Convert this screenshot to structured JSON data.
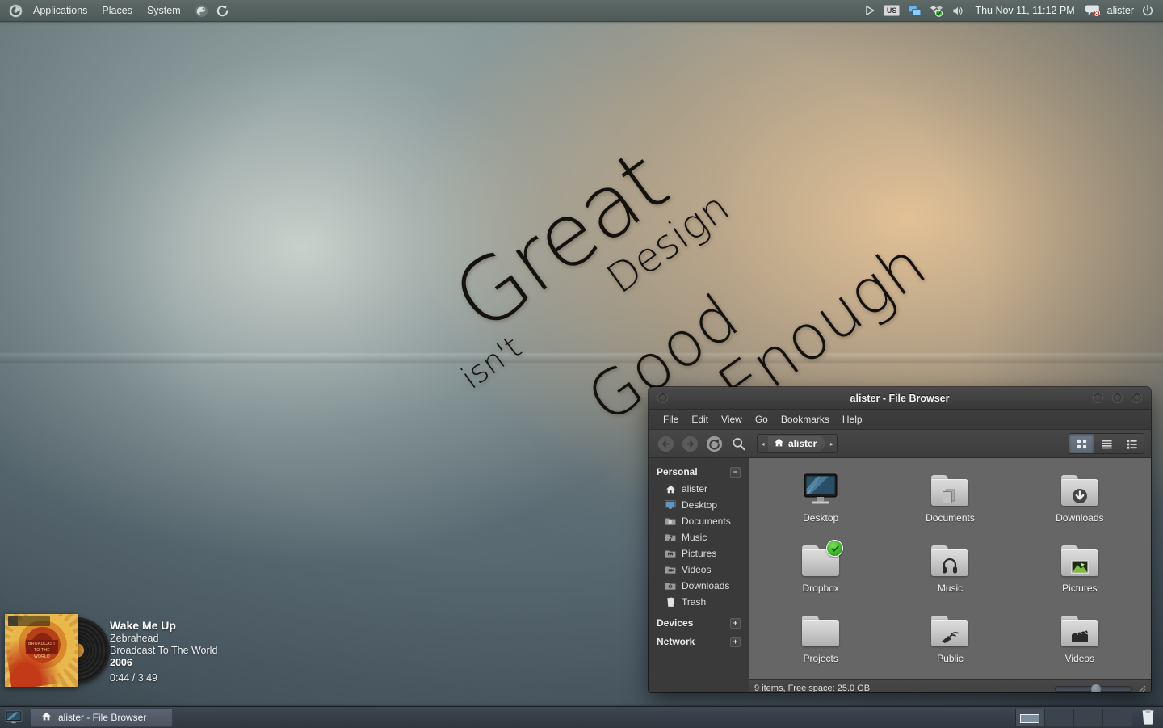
{
  "top_panel": {
    "menus": [
      {
        "label": "Applications",
        "name": "menu-applications"
      },
      {
        "label": "Places",
        "name": "menu-places"
      },
      {
        "label": "System",
        "name": "menu-system"
      }
    ],
    "launchers": [
      {
        "icon": "firefox-icon",
        "title": "Firefox Web Browser"
      },
      {
        "icon": "update-manager-icon",
        "title": "Update Manager"
      }
    ],
    "tray": [
      {
        "icon": "media-play-icon",
        "title": "Media player"
      },
      {
        "icon": "keyboard-layout-indicator",
        "label": "US"
      },
      {
        "icon": "display-monitors-icon",
        "title": "Displays"
      },
      {
        "icon": "dropbox-icon",
        "title": "Dropbox"
      },
      {
        "icon": "volume-speaker-icon",
        "title": "Volume"
      }
    ],
    "clock": "Thu Nov 11, 11:12 PM",
    "messaging_icon": "chat-bubble-icon",
    "username": "alister",
    "power_icon": "power-icon"
  },
  "wallpaper": {
    "line1": "Great",
    "line2": "Design",
    "line3": "isn't",
    "line4": "Good",
    "line5": "Enough"
  },
  "music_osd": {
    "title": "Wake Me Up",
    "artist": "Zebrahead",
    "album": "Broadcast To The World",
    "year": "2006",
    "time": "0:44 / 3:49",
    "album_art_text": "BROADCAST TO THE WORLD",
    "album_art_band": "Zebrahead"
  },
  "file_browser": {
    "title": "alister - File Browser",
    "window_buttons": [
      {
        "name": "minimize-button"
      },
      {
        "name": "maximize-button"
      },
      {
        "name": "close-button"
      }
    ],
    "menus": [
      {
        "label": "File",
        "name": "fb-menu-file"
      },
      {
        "label": "Edit",
        "name": "fb-menu-edit"
      },
      {
        "label": "View",
        "name": "fb-menu-view"
      },
      {
        "label": "Go",
        "name": "fb-menu-go"
      },
      {
        "label": "Bookmarks",
        "name": "fb-menu-bookmarks"
      },
      {
        "label": "Help",
        "name": "fb-menu-help"
      }
    ],
    "toolbar": {
      "back": "back-icon",
      "forward": "forward-icon",
      "reload": "reload-icon",
      "search": "search-icon",
      "path_crumb": "alister",
      "path_prev_arrow": "◂",
      "path_next_arrow": "▸"
    },
    "view_modes": [
      {
        "name": "icon-view-button",
        "active": true
      },
      {
        "name": "list-view-button",
        "active": false
      },
      {
        "name": "compact-view-button",
        "active": false
      }
    ],
    "sidebar": {
      "sections": [
        {
          "title": "Personal",
          "expander": "−",
          "items": [
            {
              "label": "alister",
              "icon": "home-icon"
            },
            {
              "label": "Desktop",
              "icon": "desktop-icon"
            },
            {
              "label": "Documents",
              "icon": "documents-folder-icon"
            },
            {
              "label": "Music",
              "icon": "music-folder-icon"
            },
            {
              "label": "Pictures",
              "icon": "pictures-folder-icon"
            },
            {
              "label": "Videos",
              "icon": "videos-folder-icon"
            },
            {
              "label": "Downloads",
              "icon": "downloads-folder-icon"
            },
            {
              "label": "Trash",
              "icon": "trash-icon"
            }
          ]
        },
        {
          "title": "Devices",
          "expander": "+",
          "items": []
        },
        {
          "title": "Network",
          "expander": "+",
          "items": []
        }
      ]
    },
    "files": [
      {
        "label": "Desktop",
        "icon": "monitor-icon",
        "type": "desktop"
      },
      {
        "label": "Documents",
        "icon": "documents-folder-icon",
        "type": "folder"
      },
      {
        "label": "Downloads",
        "icon": "downloads-folder-icon",
        "type": "folder"
      },
      {
        "label": "Dropbox",
        "icon": "dropbox-folder-icon",
        "type": "folder",
        "badge": "sync-ok-badge"
      },
      {
        "label": "Music",
        "icon": "music-folder-icon",
        "type": "folder"
      },
      {
        "label": "Pictures",
        "icon": "pictures-folder-icon",
        "type": "folder"
      },
      {
        "label": "Projects",
        "icon": "plain-folder-icon",
        "type": "folder"
      },
      {
        "label": "Public",
        "icon": "public-folder-icon",
        "type": "folder"
      },
      {
        "label": "Videos",
        "icon": "videos-folder-icon",
        "type": "folder"
      }
    ],
    "status": "9 items, Free space: 25.0 GB",
    "zoom_value": 50
  },
  "bottom_panel": {
    "show_desktop_icon": "show-desktop-icon",
    "tasks": [
      {
        "label": "alister - File Browser",
        "icon": "home-icon"
      }
    ],
    "workspaces": [
      {
        "name": "workspace-1",
        "active": true
      },
      {
        "name": "workspace-2",
        "active": false
      },
      {
        "name": "workspace-3",
        "active": false
      },
      {
        "name": "workspace-4",
        "active": false
      }
    ],
    "trash_icon": "trash-icon"
  },
  "colors": {
    "top_panel": "#566260",
    "bottom_panel": "#374049",
    "window_chrome": "#3d3d3d",
    "sidebar": "#3a3a3a",
    "file_area": "#666666",
    "accent_selected": "#5d6874",
    "sync_badge_green": "#2fa81e"
  }
}
